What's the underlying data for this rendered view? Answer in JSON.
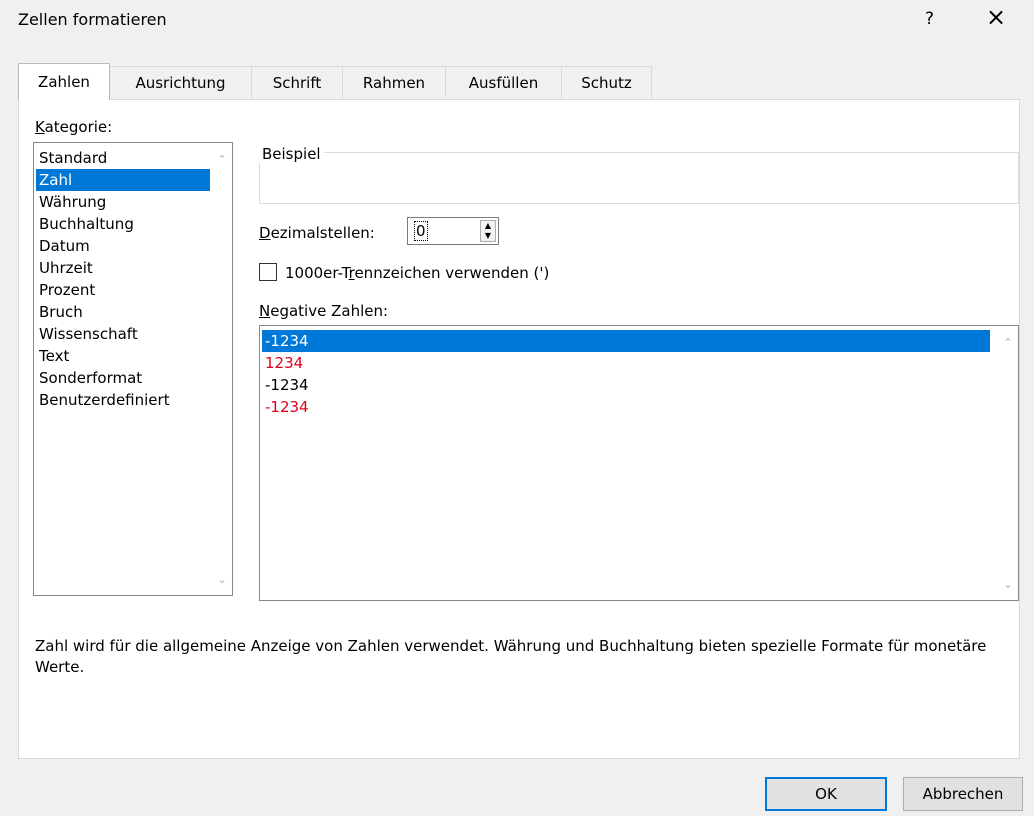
{
  "window": {
    "title": "Zellen formatieren",
    "help": "?",
    "close": "×"
  },
  "tabs": [
    {
      "label": "Zahlen"
    },
    {
      "label": "Ausrichtung"
    },
    {
      "label": "Schrift"
    },
    {
      "label": "Rahmen"
    },
    {
      "label": "Ausfüllen"
    },
    {
      "label": "Schutz"
    }
  ],
  "category": {
    "label_access": "K",
    "label_rest": "ategorie:",
    "items": [
      "Standard",
      "Zahl",
      "Währung",
      "Buchhaltung",
      "Datum",
      "Uhrzeit",
      "Prozent",
      "Bruch",
      "Wissenschaft",
      "Text",
      "Sonderformat",
      "Benutzerdefiniert"
    ],
    "selected": "Zahl"
  },
  "sample": {
    "title": "Beispiel"
  },
  "decimals": {
    "label_access": "D",
    "label_rest": "ezimalstellen:",
    "value": "0"
  },
  "separator": {
    "label_pre": "1000er-T",
    "label_access": "r",
    "label_post": "ennzeichen verwenden (')",
    "checked": false
  },
  "negative": {
    "label_access": "N",
    "label_rest": "egative Zahlen:",
    "items": [
      {
        "text": "-1234",
        "color": "#000000"
      },
      {
        "text": "1234",
        "color": "#e0001b"
      },
      {
        "text": "-1234",
        "color": "#000000"
      },
      {
        "text": "-1234",
        "color": "#e0001b"
      }
    ],
    "selected_index": 0
  },
  "description": "Zahl wird für die allgemeine Anzeige von Zahlen verwendet. Währung und Buchhaltung bieten spezielle Formate für monetäre Werte.",
  "buttons": {
    "ok": "OK",
    "cancel": "Abbrechen"
  },
  "colors": {
    "accent": "#0078d7",
    "negative_red": "#e0001b"
  }
}
